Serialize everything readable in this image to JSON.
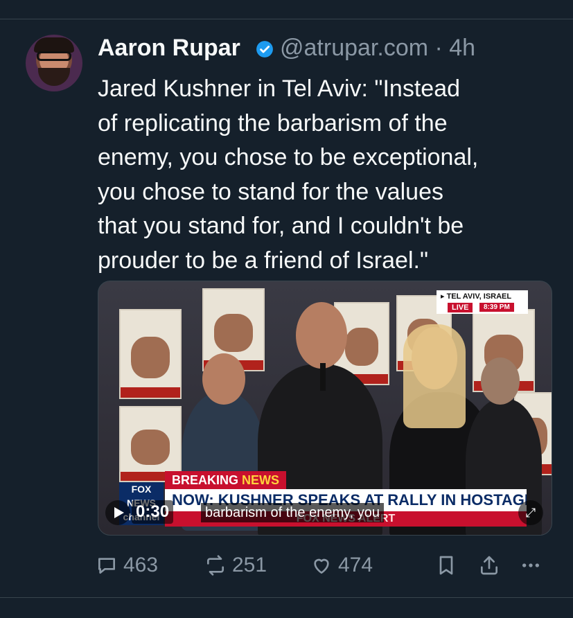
{
  "tweet": {
    "author_name": "Aaron Rupar",
    "handle_time": "@atrupar.com · 4h",
    "text": "Jared Kushner in Tel Aviv: \"Instead\nof replicating the barbarism of the\nenemy, you chose to be exceptional,\nyou chose to stand for the values\nthat you stand for, and I couldn't be\nprouder to be a friend of Israel.\""
  },
  "video": {
    "location_tag": "▸ TEL AVIV, ISRAEL",
    "live_label": "LIVE",
    "live_time": "8:39 PM",
    "breaking_label": "BREAKING",
    "breaking_news": "NEWS",
    "headline": "NOW: KUSHNER SPEAKS AT RALLY IN HOSTAGES SQUARE",
    "alert_label": "FOX NEWS ALERT",
    "network_logo": "FOX NEWS channel",
    "timestamp": "0:30",
    "caption": "barbarism of the enemy, you"
  },
  "actions": {
    "replies": "463",
    "reposts": "251",
    "likes": "474"
  },
  "colors": {
    "background": "#15202b",
    "verified": "#1d9bf0",
    "muted": "#8b98a5"
  },
  "icons": [
    "verified-badge-icon",
    "reply-icon",
    "repost-icon",
    "like-icon",
    "bookmark-icon",
    "share-icon",
    "more-icon",
    "play-icon",
    "mute-icon"
  ]
}
